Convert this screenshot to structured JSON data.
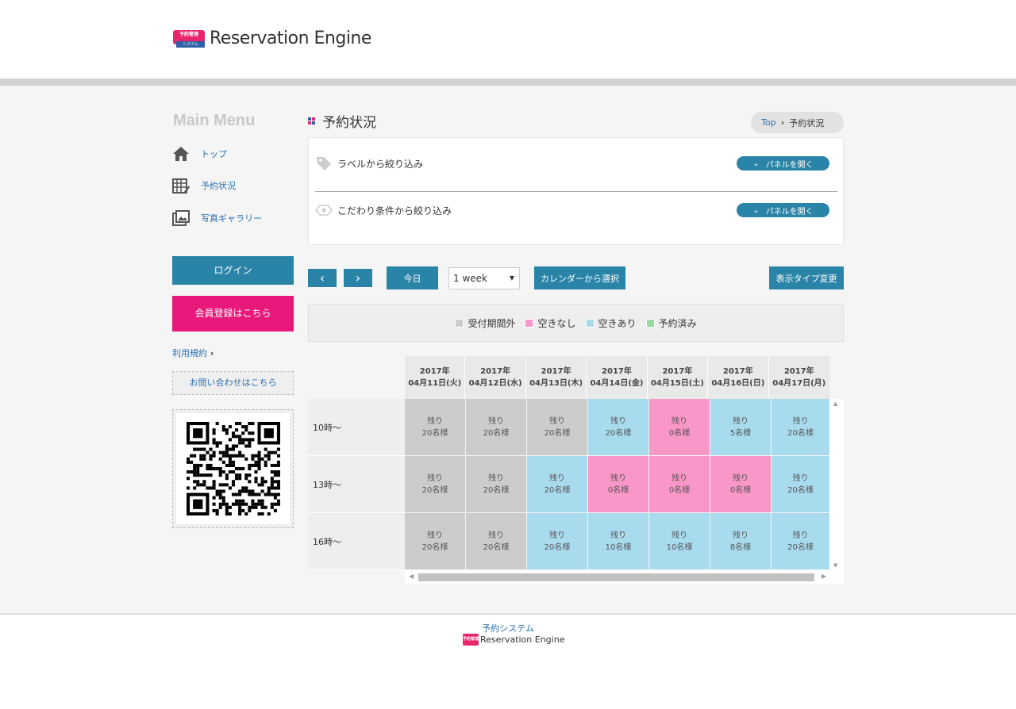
{
  "header": {
    "logo_badge_top": "予約管理",
    "logo_badge_bottom": "システム",
    "logo_text": "Reservation Engine"
  },
  "sidebar": {
    "title": "Main Menu",
    "items": [
      {
        "label": "トップ",
        "icon": "home-icon"
      },
      {
        "label": "予約状況",
        "icon": "calendar-icon"
      },
      {
        "label": "写真ギャラリー",
        "icon": "gallery-icon"
      }
    ],
    "login_label": "ログイン",
    "register_label": "会員登録はこちら",
    "terms_label": "利用規約",
    "contact_label": "お問い合わせはこちら"
  },
  "page": {
    "title": "予約状況",
    "breadcrumb_top": "Top",
    "breadcrumb_current": "予約状況"
  },
  "filters": {
    "label_filter": "ラベルから絞り込み",
    "condition_filter": "こだわり条件から絞り込み",
    "open_panel_label": "パネルを開く"
  },
  "toolbar": {
    "prev": "‹",
    "next": "›",
    "today": "今日",
    "range": "1 week",
    "calendar_select": "カレンダーから選択",
    "display_type": "表示タイプ変更"
  },
  "legend": [
    {
      "label": "受付期間外",
      "color": "#cccccc"
    },
    {
      "label": "空きなし",
      "color": "#f997c8"
    },
    {
      "label": "空きあり",
      "color": "#a9dbee"
    },
    {
      "label": "予約済み",
      "color": "#99d9a0"
    }
  ],
  "calendar": {
    "days": [
      {
        "year": "2017年",
        "date": "04月11日(火)"
      },
      {
        "year": "2017年",
        "date": "04月12日(水)"
      },
      {
        "year": "2017年",
        "date": "04月13日(木)"
      },
      {
        "year": "2017年",
        "date": "04月14日(金)"
      },
      {
        "year": "2017年",
        "date": "04月15日(土)"
      },
      {
        "year": "2017年",
        "date": "04月16日(日)"
      },
      {
        "year": "2017年",
        "date": "04月17日(月)"
      }
    ],
    "remain_label": "残り",
    "rows": [
      {
        "time": "10時～",
        "cells": [
          {
            "count": "20名様",
            "status": "grey"
          },
          {
            "count": "20名様",
            "status": "grey"
          },
          {
            "count": "20名様",
            "status": "grey"
          },
          {
            "count": "20名様",
            "status": "blue"
          },
          {
            "count": "0名様",
            "status": "pink"
          },
          {
            "count": "5名様",
            "status": "blue"
          },
          {
            "count": "20名様",
            "status": "blue"
          }
        ]
      },
      {
        "time": "13時～",
        "cells": [
          {
            "count": "20名様",
            "status": "grey"
          },
          {
            "count": "20名様",
            "status": "grey"
          },
          {
            "count": "20名様",
            "status": "blue"
          },
          {
            "count": "0名様",
            "status": "pink"
          },
          {
            "count": "0名様",
            "status": "pink"
          },
          {
            "count": "0名様",
            "status": "pink"
          },
          {
            "count": "20名様",
            "status": "blue"
          }
        ]
      },
      {
        "time": "16時～",
        "cells": [
          {
            "count": "20名様",
            "status": "grey"
          },
          {
            "count": "20名様",
            "status": "grey"
          },
          {
            "count": "20名様",
            "status": "blue"
          },
          {
            "count": "10名様",
            "status": "blue"
          },
          {
            "count": "10名様",
            "status": "blue"
          },
          {
            "count": "8名様",
            "status": "blue"
          },
          {
            "count": "20名様",
            "status": "blue"
          }
        ]
      }
    ]
  },
  "footer": {
    "system_label": "予約システム",
    "logo_text": "Reservation Engine"
  }
}
